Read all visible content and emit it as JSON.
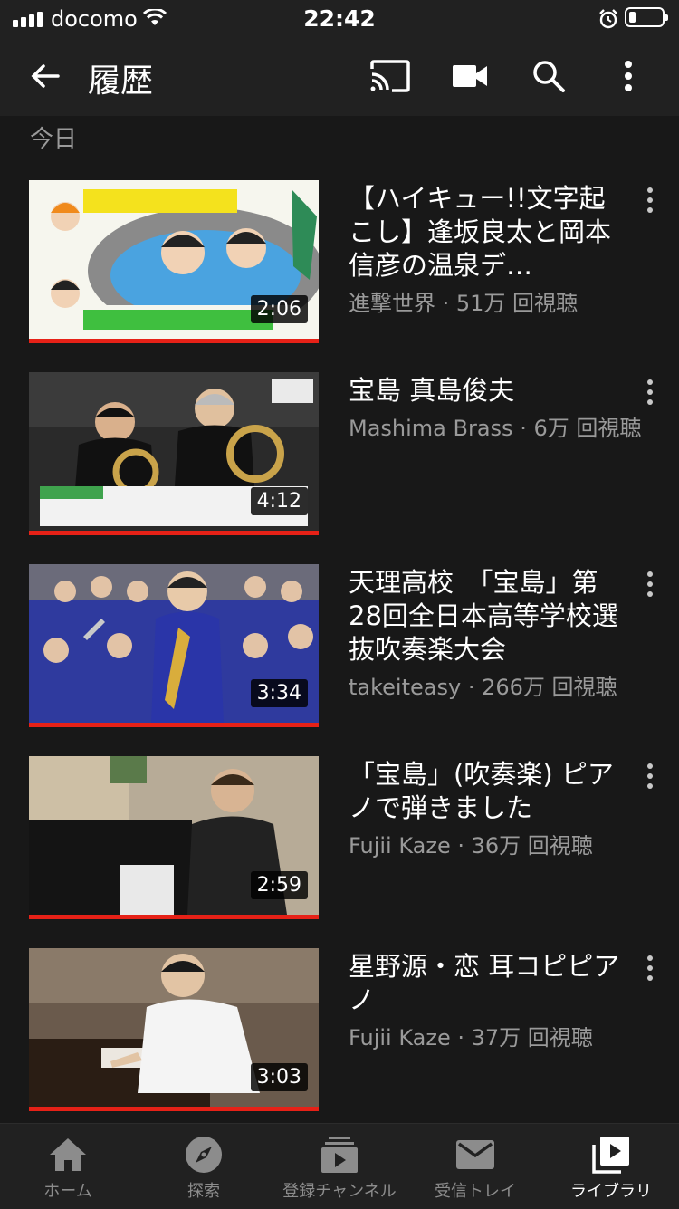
{
  "status_bar": {
    "carrier": "docomo",
    "time": "22:42",
    "battery_level": 0.2
  },
  "app_bar": {
    "title": "履歴",
    "icons": [
      "back-arrow-icon",
      "cast-icon",
      "video-camera-icon",
      "search-icon",
      "more-vert-icon"
    ]
  },
  "section": {
    "label": "今日"
  },
  "videos": [
    {
      "title": "【ハイキュー!!文字起こし】逢坂良太と岡本信彦の温泉デ…",
      "channel": "進撃世界",
      "views": "51万 回視聴",
      "meta": "進撃世界 · 51万 回視聴",
      "duration": "2:06",
      "watched_fraction": 1.0
    },
    {
      "title": "宝島 真島俊夫",
      "channel": "Mashima Brass",
      "views": "6万 回視聴",
      "meta": "Mashima Brass · 6万 回視聴",
      "duration": "4:12",
      "watched_fraction": 1.0
    },
    {
      "title": "天理高校　「宝島」第28回全日本高等学校選抜吹奏楽大会",
      "channel": "takeiteasy",
      "views": "266万 回視聴",
      "meta": "takeiteasy · 266万 回視聴",
      "duration": "3:34",
      "watched_fraction": 1.0
    },
    {
      "title": "「宝島」(吹奏楽) ピアノで弾きました",
      "channel": "Fujii Kaze",
      "views": "36万 回視聴",
      "meta": "Fujii Kaze · 36万 回視聴",
      "duration": "2:59",
      "watched_fraction": 1.0
    },
    {
      "title": "星野源・恋 耳コピピアノ",
      "channel": "Fujii Kaze",
      "views": "37万 回視聴",
      "meta": "Fujii Kaze · 37万 回視聴",
      "duration": "3:03",
      "watched_fraction": 1.0
    }
  ],
  "bottom_nav": {
    "items": [
      {
        "label": "ホーム",
        "icon": "home-icon"
      },
      {
        "label": "探索",
        "icon": "compass-icon"
      },
      {
        "label": "登録チャンネル",
        "icon": "subscriptions-icon"
      },
      {
        "label": "受信トレイ",
        "icon": "mail-icon"
      },
      {
        "label": "ライブラリ",
        "icon": "library-icon",
        "active": true
      }
    ]
  },
  "colors": {
    "background": "#181818",
    "bar": "#212121",
    "progress": "#e62117",
    "secondary_text": "#9a9a9a"
  }
}
